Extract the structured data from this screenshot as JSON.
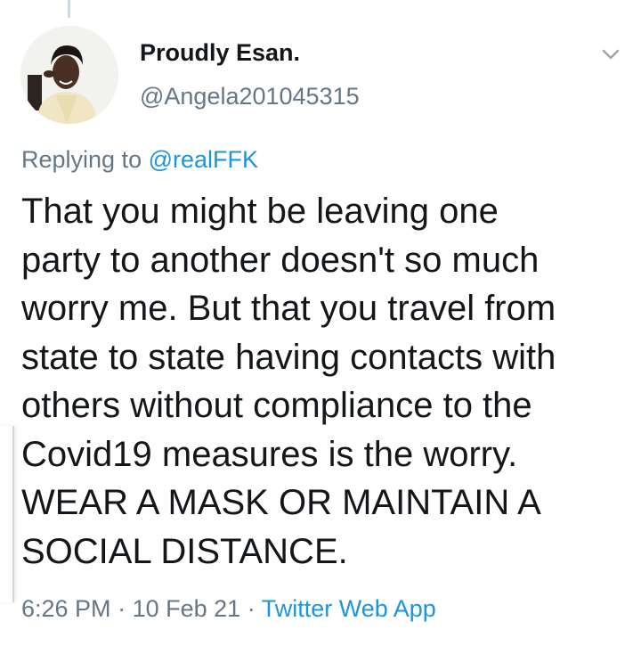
{
  "author": {
    "display_name": "Proudly Esan.",
    "handle": "@Angela201045315"
  },
  "reply": {
    "prefix": "Replying to",
    "mention": "@realFFK"
  },
  "tweet": {
    "lines": [
      "That you might be leaving one",
      "party to another doesn't so much",
      "worry me. But that you travel from",
      "state to state having contacts with",
      "others without compliance to the",
      "Covid19 measures is the worry.",
      "WEAR A MASK OR MAINTAIN A",
      "SOCIAL DISTANCE."
    ]
  },
  "meta": {
    "time": "6:26 PM",
    "date": "10 Feb 21",
    "separator": "·",
    "source": "Twitter Web App"
  },
  "icons": {
    "menu": "chevron-down-icon"
  },
  "colors": {
    "text_primary": "#14171a",
    "text_secondary": "#657786",
    "link": "#1b95e0"
  }
}
